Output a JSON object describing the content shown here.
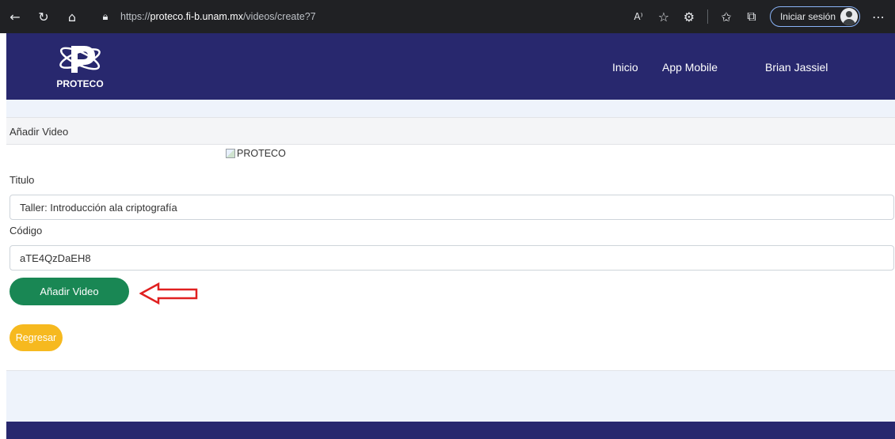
{
  "browser": {
    "url_prefix": "https://",
    "url_host": "proteco.fi-b.unam.mx",
    "url_path": "/videos/create?7",
    "signin_label": "Iniciar sesión",
    "icons": [
      "back-icon",
      "refresh-icon",
      "home-icon",
      "lock-icon",
      "read-aloud-icon",
      "favorite-add-icon",
      "extensions-icon",
      "favorites-icon",
      "collections-icon",
      "more-icon"
    ]
  },
  "site": {
    "logo_text": "PROTECO",
    "menu": {
      "inicio": "Inicio",
      "app_mobile": "App Mobile",
      "user": "Brian Jassiel"
    }
  },
  "form": {
    "header": "Añadir Video",
    "broken_image_alt": "PROTECO",
    "titulo_label": "Titulo",
    "titulo_value": "Taller: Introducción ala criptografía",
    "codigo_label": "Código",
    "codigo_value": "aTE4QzDaEH8",
    "submit_label": "Añadir Video",
    "back_label": "Regresar"
  },
  "colors": {
    "navbar": "#28286e",
    "submit": "#198754",
    "back": "#f6b91f",
    "annotation_arrow": "#e02020"
  }
}
